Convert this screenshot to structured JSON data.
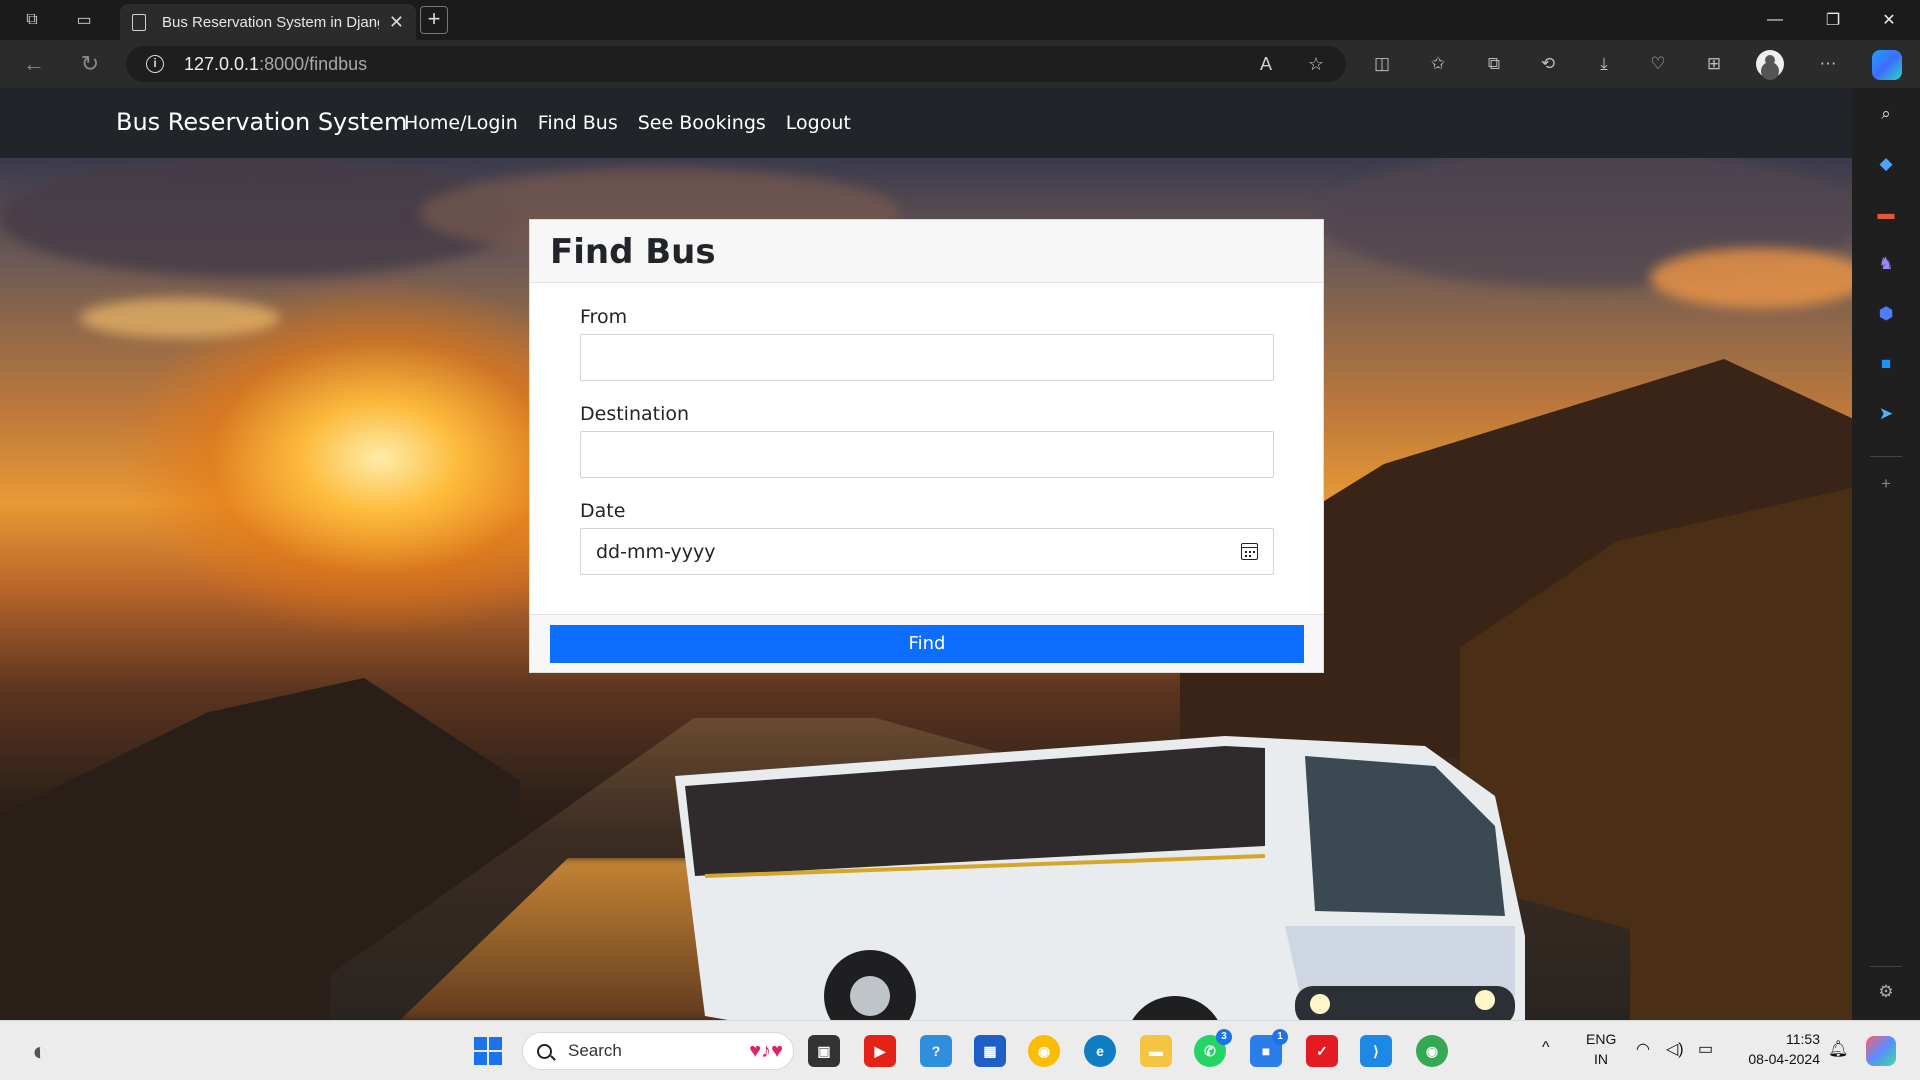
{
  "browser": {
    "tab_title": "Bus Reservation System in Djang",
    "tab_close": "✕",
    "new_tab": "+",
    "url_host": "127.0.0.1",
    "url_path": ":8000/findbus",
    "window_controls": {
      "minimize": "—",
      "maximize": "❐",
      "close": "✕"
    }
  },
  "navbar": {
    "brand": "Bus Reservation System",
    "links": [
      "Home/Login",
      "Find Bus",
      "See Bookings",
      "Logout"
    ]
  },
  "form": {
    "title": "Find Bus",
    "from_label": "From",
    "from_value": "",
    "destination_label": "Destination",
    "destination_value": "",
    "date_label": "Date",
    "date_placeholder": "dd-mm-yyyy",
    "submit_label": "Find"
  },
  "taskbar": {
    "search_label": "Search",
    "language": "ENG",
    "region": "IN",
    "time": "11:53",
    "date": "08-04-2024",
    "whatsapp_badge": "3",
    "app_badge": "1"
  },
  "colors": {
    "navbar_bg": "#212529",
    "primary_button": "#0d6efd",
    "card_bg": "#ffffff"
  }
}
